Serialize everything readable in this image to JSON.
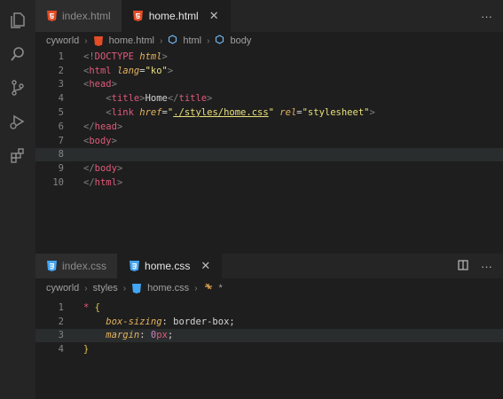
{
  "colors": {
    "html_icon": "#e44d26",
    "css_icon": "#42a5f5",
    "tag": "#e05a7a",
    "attr": "#e4b35d",
    "string": "#e8e07a",
    "number": "#c586c0"
  },
  "activity_bar": {
    "icons": [
      "files-icon",
      "search-icon",
      "source-control-icon",
      "run-debug-icon",
      "extensions-icon"
    ]
  },
  "top_pane": {
    "tabs": [
      {
        "label": "index.html",
        "icon": "html-file-icon",
        "active": false
      },
      {
        "label": "home.html",
        "icon": "html-file-icon",
        "active": true,
        "close": "✕"
      }
    ],
    "more": "···",
    "breadcrumbs": [
      "cyworld",
      "home.html",
      "html",
      "body"
    ],
    "line_numbers": [
      "1",
      "2",
      "3",
      "4",
      "5",
      "6",
      "7",
      "8",
      "9",
      "10"
    ],
    "code": {
      "l1": {
        "a": "<!",
        "b": "DOCTYPE",
        "c": " html",
        "d": ">"
      },
      "l2": {
        "a": "<",
        "b": "html",
        "c": " lang",
        "d": "=",
        "e": "\"ko\"",
        "f": ">"
      },
      "l3": {
        "a": "<",
        "b": "head",
        "c": ">"
      },
      "l4": {
        "a": "<",
        "b": "title",
        "c": ">",
        "d": "Home",
        "e": "</",
        "f": "title",
        "g": ">"
      },
      "l5": {
        "a": "<",
        "b": "link",
        "c": " href",
        "d": "=",
        "e": "\"",
        "f": "./styles/home.css",
        "g": "\"",
        "h": " rel",
        "i": "=",
        "j": "\"stylesheet\"",
        "k": ">"
      },
      "l6": {
        "a": "</",
        "b": "head",
        "c": ">"
      },
      "l7": {
        "a": "<",
        "b": "body",
        "c": ">"
      },
      "l9": {
        "a": "</",
        "b": "body",
        "c": ">"
      },
      "l10": {
        "a": "</",
        "b": "html",
        "c": ">"
      }
    }
  },
  "bottom_pane": {
    "tabs": [
      {
        "label": "index.css",
        "icon": "css-file-icon",
        "active": false
      },
      {
        "label": "home.css",
        "icon": "css-file-icon",
        "active": true,
        "close": "✕"
      }
    ],
    "more": "···",
    "breadcrumbs": [
      "cyworld",
      "styles",
      "home.css",
      "*"
    ],
    "line_numbers": [
      "1",
      "2",
      "3",
      "4"
    ],
    "code": {
      "l1": {
        "a": "*",
        "b": " {"
      },
      "l2": {
        "a": "box-sizing",
        "b": ": ",
        "c": "border-box",
        "d": ";"
      },
      "l3": {
        "a": "margin",
        "b": ": ",
        "c": "0",
        "d": "px",
        "e": ";"
      },
      "l4": {
        "a": "}"
      }
    }
  }
}
